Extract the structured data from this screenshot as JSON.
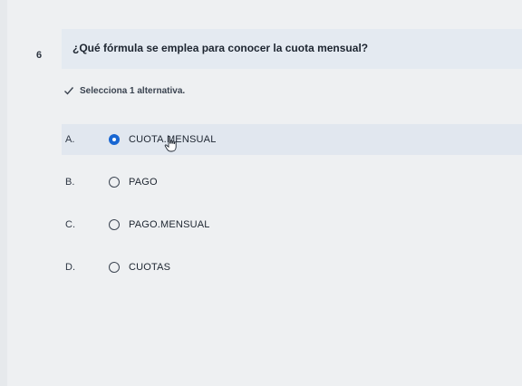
{
  "question": {
    "number": "6",
    "text": "¿Qué fórmula se emplea para conocer la cuota mensual?"
  },
  "instruction": {
    "text": "Selecciona 1 alternativa.",
    "icon": "check-icon"
  },
  "options": [
    {
      "letter": "A.",
      "text": "CUOTA.MENSUAL",
      "selected": true
    },
    {
      "letter": "B.",
      "text": "PAGO",
      "selected": false
    },
    {
      "letter": "C.",
      "text": "PAGO.MENSUAL",
      "selected": false
    },
    {
      "letter": "D.",
      "text": "CUOTAS",
      "selected": false
    }
  ],
  "colors": {
    "accent": "#1967d2",
    "selected_row": "#e1e7ef",
    "question_band": "#e4eaf1"
  }
}
